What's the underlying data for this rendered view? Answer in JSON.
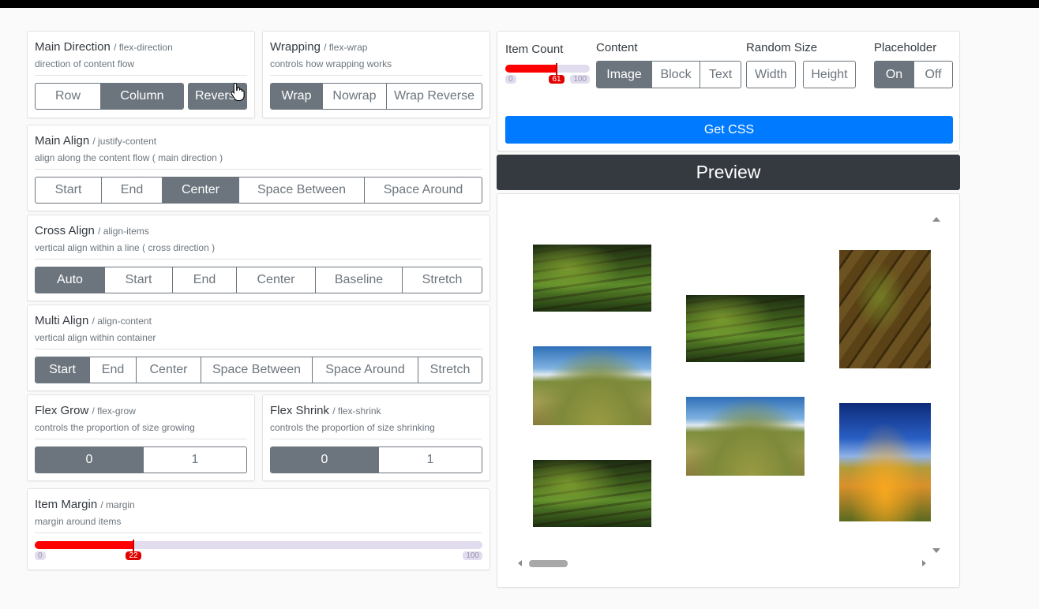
{
  "main_direction": {
    "title": "Main Direction",
    "subtitle": "/ flex-direction",
    "description": "direction of content flow",
    "options": [
      "Row",
      "Column",
      "Reverse"
    ],
    "selected": "Column"
  },
  "wrapping": {
    "title": "Wrapping",
    "subtitle": "/ flex-wrap",
    "description": "controls how wrapping works",
    "options": [
      "Wrap",
      "Nowrap",
      "Wrap Reverse"
    ],
    "selected": "Wrap"
  },
  "main_align": {
    "title": "Main Align",
    "subtitle": "/ justify-content",
    "description": "align along the content flow ( main direction )",
    "options": [
      "Start",
      "End",
      "Center",
      "Space Between",
      "Space Around"
    ],
    "selected": "Center"
  },
  "cross_align": {
    "title": "Cross Align",
    "subtitle": "/ align-items",
    "description": "vertical align within a line ( cross direction )",
    "options": [
      "Auto",
      "Start",
      "End",
      "Center",
      "Baseline",
      "Stretch"
    ],
    "selected": "Auto"
  },
  "multi_align": {
    "title": "Multi Align",
    "subtitle": "/ align-content",
    "description": "vertical align within container",
    "options": [
      "Start",
      "End",
      "Center",
      "Space Between",
      "Space Around",
      "Stretch"
    ],
    "selected": "Start"
  },
  "flex_grow": {
    "title": "Flex Grow",
    "subtitle": "/ flex-grow",
    "description": "controls the proportion of size growing",
    "options": [
      "0",
      "1"
    ],
    "selected": "0"
  },
  "flex_shrink": {
    "title": "Flex Shrink",
    "subtitle": "/ flex-shrink",
    "description": "controls the proportion of size shrinking",
    "options": [
      "0",
      "1"
    ],
    "selected": "0"
  },
  "item_margin": {
    "title": "Item Margin",
    "subtitle": "/ margin",
    "description": "margin around items",
    "min": "0",
    "max": "100",
    "value": "22",
    "fraction": 0.22
  },
  "item_count": {
    "label": "Item Count",
    "min": "0",
    "max": "100",
    "value": "61",
    "fraction": 0.61
  },
  "content": {
    "label": "Content",
    "options": [
      "Image",
      "Block",
      "Text"
    ],
    "selected": "Image"
  },
  "random_size": {
    "label": "Random Size",
    "options": [
      "Width",
      "Height"
    ]
  },
  "placeholder": {
    "label": "Placeholder",
    "options": [
      "On",
      "Off"
    ],
    "selected": "On"
  },
  "get_css_label": "Get CSS",
  "preview_title": "Preview",
  "colors": {
    "accent": "#007bff",
    "active_button": "#6c757d",
    "preview_bar": "#343a40",
    "slider_fill": "#ff0000",
    "slider_track": "#e2dcef"
  },
  "icons": {
    "cursor": "hand-pointer-icon",
    "scroll_up": "scroll-up-arrow-icon",
    "scroll_down": "scroll-down-arrow-icon",
    "scroll_left": "scroll-left-arrow-icon",
    "scroll_right": "scroll-right-arrow-icon"
  }
}
